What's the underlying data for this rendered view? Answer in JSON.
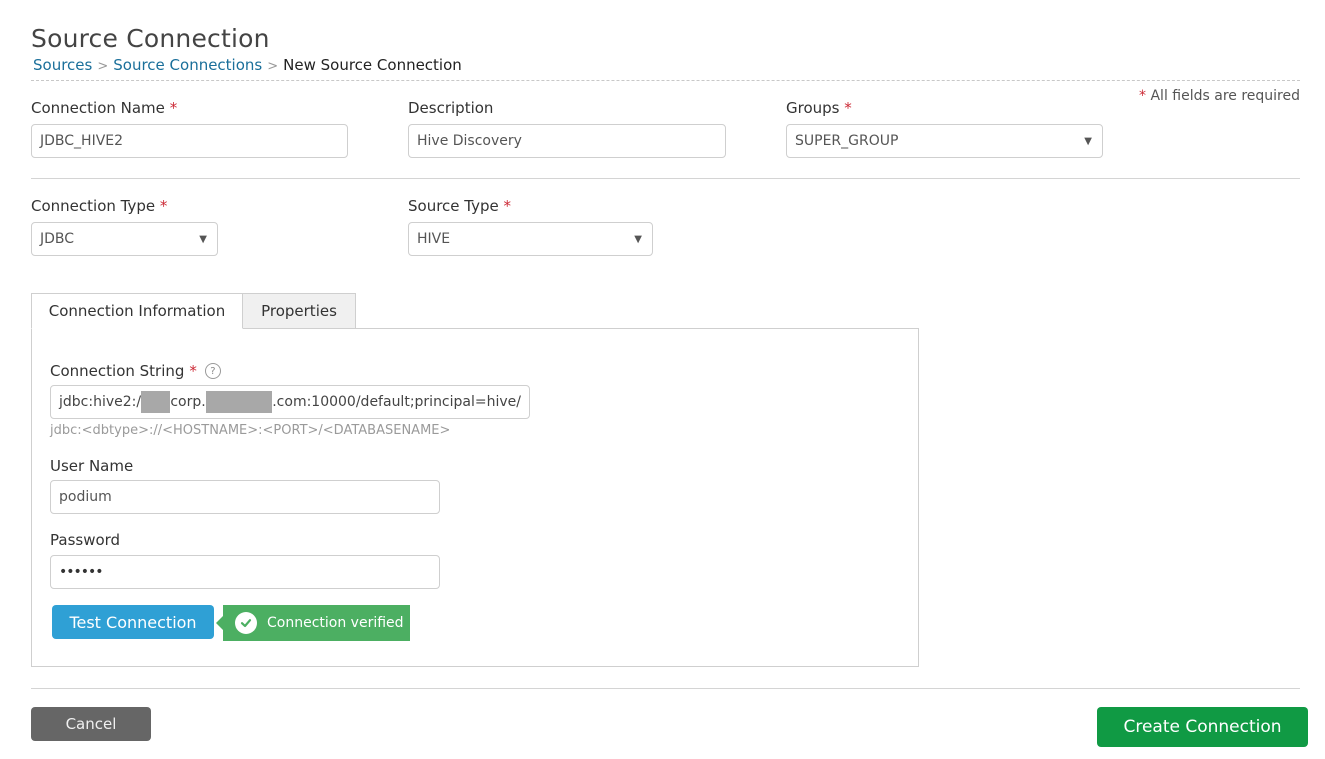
{
  "page": {
    "title": "Source Connection",
    "breadcrumb": {
      "items": [
        "Sources",
        "Source Connections"
      ],
      "current": "New Source Connection",
      "separator": ">"
    },
    "required_note": "All fields are required",
    "required_marker": "*"
  },
  "form": {
    "connection_name": {
      "label": "Connection Name",
      "value": "JDBC_HIVE2"
    },
    "description": {
      "label": "Description",
      "value": "Hive Discovery"
    },
    "groups": {
      "label": "Groups",
      "value": "SUPER_GROUP"
    },
    "connection_type": {
      "label": "Connection Type",
      "value": "JDBC"
    },
    "source_type": {
      "label": "Source Type",
      "value": "HIVE"
    }
  },
  "tabs": [
    {
      "label": "Connection Information",
      "active": true
    },
    {
      "label": "Properties",
      "active": false
    }
  ],
  "connection_info": {
    "connection_string": {
      "label": "Connection String",
      "value_prefix": "jdbc:hive2:/",
      "value_middle": "corp.",
      "value_suffix": ".com:10000/default;principal=hive/",
      "hint": "jdbc:<dbtype>://<HOSTNAME>:<PORT>/<DATABASENAME>"
    },
    "user_name": {
      "label": "User Name",
      "value": "podium"
    },
    "password": {
      "label": "Password",
      "value": "••••••"
    },
    "test_button": "Test Connection",
    "verified_message": "Connection verified"
  },
  "actions": {
    "cancel": "Cancel",
    "create": "Create Connection"
  },
  "icons": {
    "help": "?",
    "caret": "▼"
  },
  "colors": {
    "link": "#1a6f9a",
    "required": "#cc2a36",
    "test_button": "#2fa0d5",
    "verified": "#4caf62",
    "create_button": "#109a44",
    "cancel_button": "#666666"
  }
}
